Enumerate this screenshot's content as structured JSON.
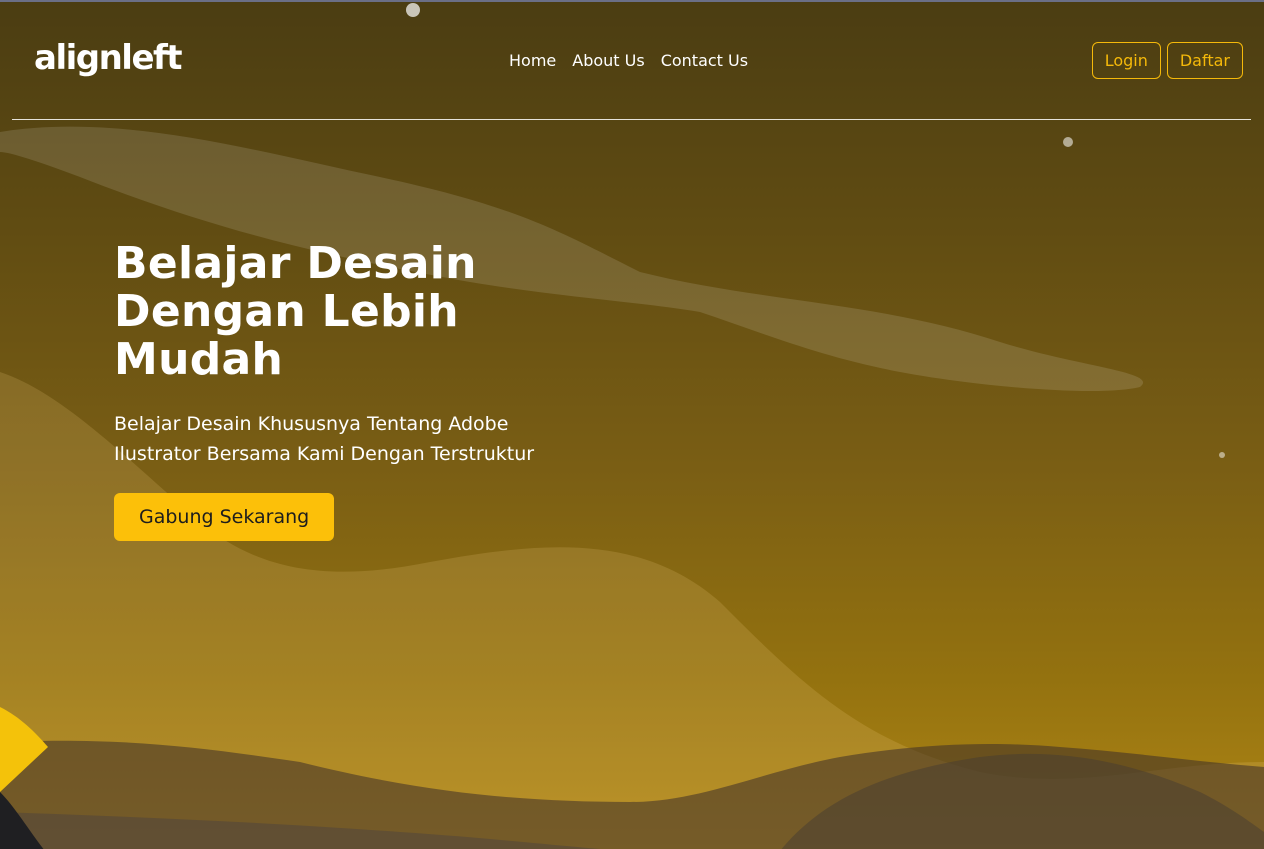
{
  "brand": {
    "logo_text": "alignleft"
  },
  "nav": {
    "links": [
      {
        "label": "Home"
      },
      {
        "label": "About Us"
      },
      {
        "label": "Contact Us"
      }
    ]
  },
  "auth": {
    "login_label": "Login",
    "register_label": "Daftar"
  },
  "hero": {
    "title": "Belajar Desain Dengan Lebih Mudah",
    "subtitle": "Belajar Desain Khususnya Tentang Adobe Ilustrator Bersama Kami Dengan Terstruktur",
    "cta_label": "Gabung Sekarang"
  },
  "colors": {
    "accent": "#fcc009",
    "outline_button": "#f5b90a",
    "background_top": "#4b3d12",
    "background_bottom": "#b08716"
  }
}
